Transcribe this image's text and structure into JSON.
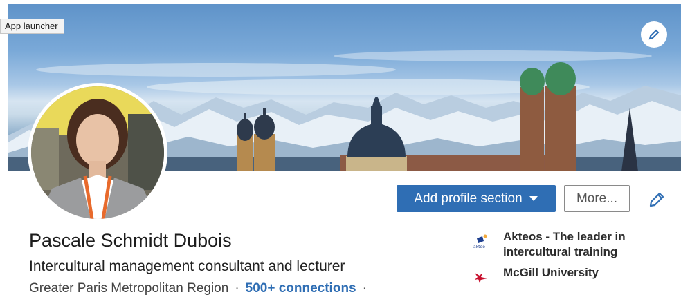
{
  "tooltip": {
    "text": "App launcher"
  },
  "profile": {
    "name": "Pascale Schmidt Dubois",
    "headline": "Intercultural management consultant and lecturer",
    "location": "Greater Paris Metropolitan Region",
    "separator": "·",
    "connections": "500+ connections"
  },
  "actions": {
    "add_profile_section": "Add profile section",
    "more": "More..."
  },
  "experience": [
    {
      "label": "Akteos - The leader in intercultural training",
      "logo_icon": "akteos-logo-icon",
      "logo_text": "akteo"
    },
    {
      "label": "McGill University",
      "logo_icon": "mcgill-logo-icon",
      "color": "#c8102e"
    }
  ],
  "colors": {
    "accent": "#2f6eb4",
    "text_primary": "#1d1d1d",
    "text_secondary": "#444444"
  },
  "icons": {
    "banner_edit": "pencil-icon",
    "intro_edit": "pencil-icon",
    "dropdown": "caret-down-icon"
  }
}
